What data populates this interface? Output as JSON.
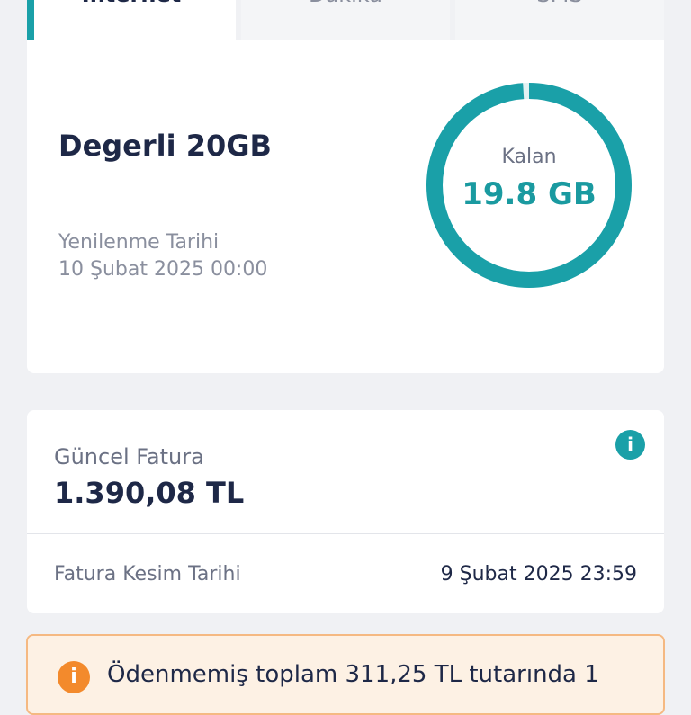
{
  "tabs": [
    {
      "label": "İnternet",
      "active": true
    },
    {
      "label": "Dakika",
      "active": false
    },
    {
      "label": "SMS",
      "active": false
    }
  ],
  "usage": {
    "plan_name": "Degerli 20GB",
    "renew_label": "Yenilenme Tarihi",
    "renew_date": "10 Şubat 2025 00:00",
    "remaining_label": "Kalan",
    "remaining_value": "19.8 GB",
    "remaining_fraction": 0.99
  },
  "bill": {
    "label": "Güncel Fatura",
    "amount": "1.390,08 TL",
    "info_icon": "info-icon",
    "info_glyph": "i",
    "cut_label": "Fatura Kesim Tarihi",
    "cut_date": "9 Şubat 2025 23:59"
  },
  "warning": {
    "icon": "warning-icon",
    "glyph": "i",
    "text": "Ödenmemiş toplam 311,25 TL tutarında 1"
  },
  "colors": {
    "accent": "#1aa0a8",
    "warning": "#f38a2c",
    "warning_bg": "#fdf1e4"
  }
}
